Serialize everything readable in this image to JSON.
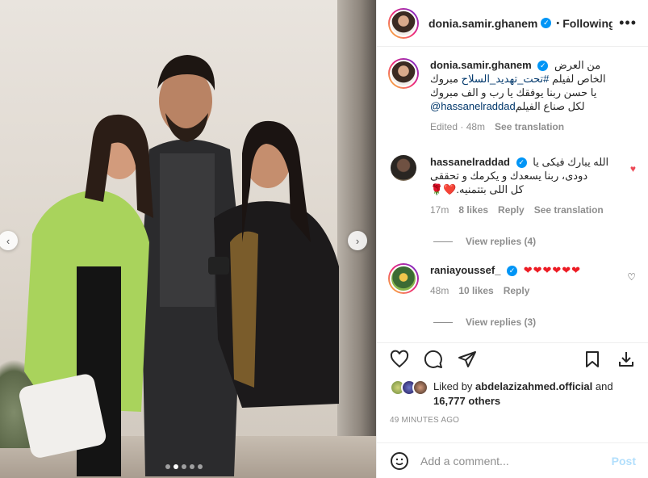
{
  "photo": {
    "prev_arrow": "‹",
    "next_arrow": "›",
    "dots_count": 5,
    "active_dot": 1
  },
  "header": {
    "username": "donia.samir.ghanem",
    "separator": "•",
    "follow_label": "Following",
    "more_label": "•••"
  },
  "caption": {
    "username": "donia.samir.ghanem",
    "line1": "من العرض",
    "line2_prefix": "الخاص لفيلم ",
    "hashtag": "#تحت_تهديد_السلاح",
    "line2_suffix": " مبروك",
    "line3": "يا حسن ربنا يوفقك يا رب و الف مبروك",
    "mention": "@hassanelraddad",
    "line4_suffix": " لكل صناع الفيلم",
    "edited": "Edited · 48m",
    "see_translation": "See translation"
  },
  "comments": [
    {
      "username": "hassanelraddad",
      "line1": "الله يبارك فيكى يا",
      "line2": "دودى، ربنا يسعدك و يكرمك و تحققى",
      "line3": "كل اللى بتتمنيه.",
      "emojis": "🌹❤️",
      "time": "17m",
      "likes": "8 likes",
      "reply": "Reply",
      "see_translation": "See translation",
      "view_replies": "View replies (4)",
      "liked": true
    },
    {
      "username": "raniayoussef_",
      "text": "❤❤❤❤❤❤",
      "time": "48m",
      "likes": "10 likes",
      "reply": "Reply",
      "view_replies": "View replies (3)",
      "liked": false
    }
  ],
  "likes": {
    "prefix": "Liked by ",
    "user": "abdelazizahmed.official",
    "middle": " and",
    "count": "16,777 others"
  },
  "timestamp": "49 MINUTES AGO",
  "add_comment": {
    "placeholder": "Add a comment...",
    "post_label": "Post"
  },
  "colors": {
    "link": "#00376b",
    "verified": "#0095f6",
    "heart": "#ed4956",
    "post_disabled": "#b2dffc"
  }
}
